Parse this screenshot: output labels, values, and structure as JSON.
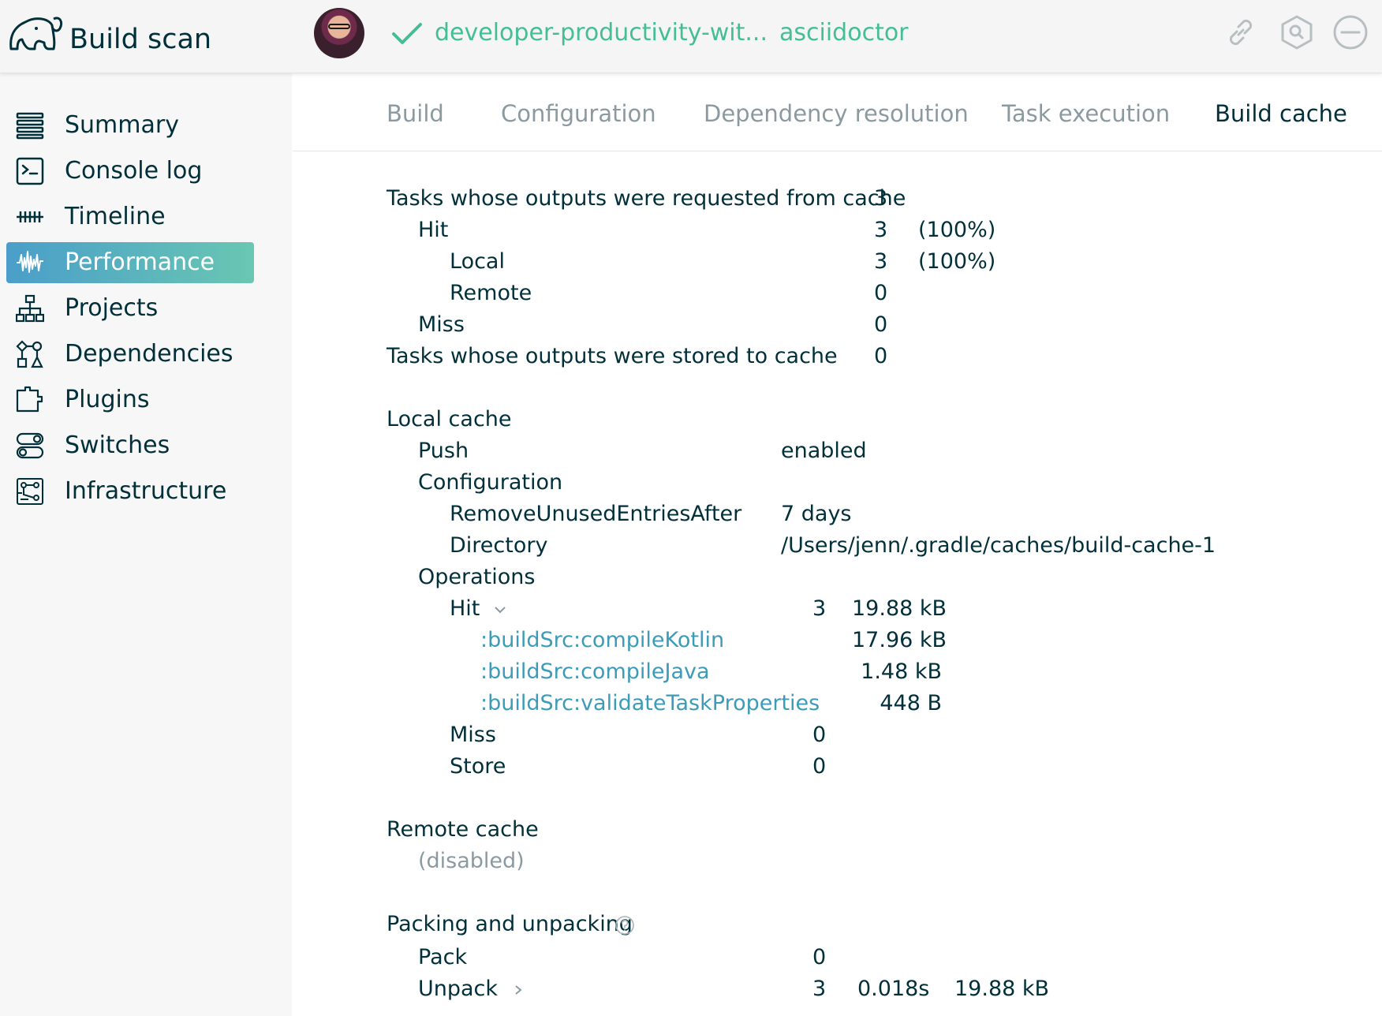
{
  "header": {
    "brand": "Build scan",
    "project_name": "developer-productivity-wit...",
    "project_tag": "asciidoctor",
    "icons": [
      "elephant-logo-icon",
      "avatar",
      "check-icon",
      "link-icon",
      "hexagon-search-icon",
      "minus-circle-icon"
    ],
    "accent_color": "#45be95"
  },
  "sidebar": {
    "items": [
      {
        "label": "Summary",
        "icon": "list-icon"
      },
      {
        "label": "Console log",
        "icon": "terminal-icon"
      },
      {
        "label": "Timeline",
        "icon": "timeline-icon"
      },
      {
        "label": "Performance",
        "icon": "waveform-icon",
        "active": true
      },
      {
        "label": "Projects",
        "icon": "hierarchy-icon"
      },
      {
        "label": "Dependencies",
        "icon": "dependencies-icon"
      },
      {
        "label": "Plugins",
        "icon": "puzzle-icon"
      },
      {
        "label": "Switches",
        "icon": "toggle-icon"
      },
      {
        "label": "Infrastructure",
        "icon": "circuit-icon"
      }
    ],
    "active_gradient": [
      "#4a9ec9",
      "#69c7b2"
    ]
  },
  "tabs": [
    {
      "label": "Build"
    },
    {
      "label": "Configuration"
    },
    {
      "label": "Dependency resolution"
    },
    {
      "label": "Task execution"
    },
    {
      "label": "Build cache",
      "active": true
    }
  ],
  "summary": {
    "requested_label": "Tasks whose outputs were requested from cache",
    "requested_count": "3",
    "hit_label": "Hit",
    "hit_count": "3",
    "hit_pct": "(100%)",
    "local_label": "Local",
    "local_count": "3",
    "local_pct": "(100%)",
    "remote_label": "Remote",
    "remote_count": "0",
    "miss_label": "Miss",
    "miss_count": "0",
    "stored_label": "Tasks whose outputs were stored to cache",
    "stored_count": "0"
  },
  "local_cache": {
    "title": "Local cache",
    "push_label": "Push",
    "push_value": "enabled",
    "configuration_label": "Configuration",
    "remove_label": "RemoveUnusedEntriesAfter",
    "remove_value": "7 days",
    "directory_label": "Directory",
    "directory_value": "/Users/jenn/.gradle/caches/build-cache-1",
    "operations_label": "Operations",
    "hit_label": "Hit",
    "hit_count": "3",
    "hit_size": "19.88 kB",
    "hit_tasks": [
      {
        "name": ":buildSrc:compileKotlin",
        "size": "17.96 kB"
      },
      {
        "name": ":buildSrc:compileJava",
        "size": "1.48 kB"
      },
      {
        "name": ":buildSrc:validateTaskProperties",
        "size": "448 B"
      }
    ],
    "miss_label": "Miss",
    "miss_count": "0",
    "store_label": "Store",
    "store_count": "0"
  },
  "remote_cache": {
    "title": "Remote cache",
    "status": "(disabled)"
  },
  "packing": {
    "title": "Packing and unpacking",
    "pack_label": "Pack",
    "pack_count": "0",
    "unpack_label": "Unpack",
    "unpack_count": "3",
    "unpack_time": "0.018s",
    "unpack_size": "19.88 kB"
  }
}
